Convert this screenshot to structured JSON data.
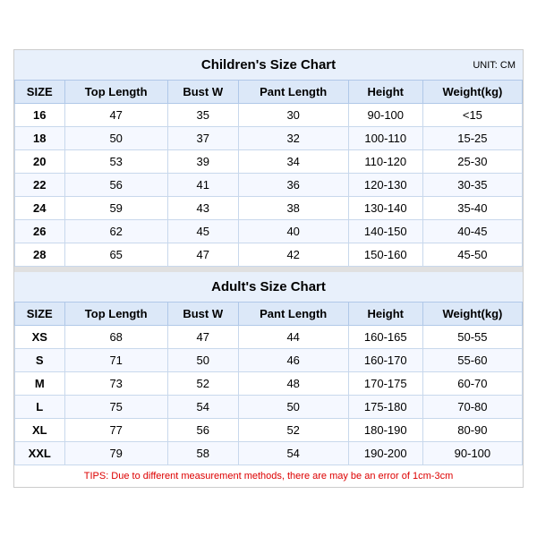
{
  "children_title": "Children's Size Chart",
  "adult_title": "Adult's Size Chart",
  "unit": "UNIT: CM",
  "tips": "TIPS: Due to different measurement methods, there are may be an error of 1cm-3cm",
  "columns": [
    "SIZE",
    "Top Length",
    "Bust W",
    "Pant Length",
    "Height",
    "Weight(kg)"
  ],
  "children_rows": [
    [
      "16",
      "47",
      "35",
      "30",
      "90-100",
      "<15"
    ],
    [
      "18",
      "50",
      "37",
      "32",
      "100-110",
      "15-25"
    ],
    [
      "20",
      "53",
      "39",
      "34",
      "110-120",
      "25-30"
    ],
    [
      "22",
      "56",
      "41",
      "36",
      "120-130",
      "30-35"
    ],
    [
      "24",
      "59",
      "43",
      "38",
      "130-140",
      "35-40"
    ],
    [
      "26",
      "62",
      "45",
      "40",
      "140-150",
      "40-45"
    ],
    [
      "28",
      "65",
      "47",
      "42",
      "150-160",
      "45-50"
    ]
  ],
  "adult_rows": [
    [
      "XS",
      "68",
      "47",
      "44",
      "160-165",
      "50-55"
    ],
    [
      "S",
      "71",
      "50",
      "46",
      "160-170",
      "55-60"
    ],
    [
      "M",
      "73",
      "52",
      "48",
      "170-175",
      "60-70"
    ],
    [
      "L",
      "75",
      "54",
      "50",
      "175-180",
      "70-80"
    ],
    [
      "XL",
      "77",
      "56",
      "52",
      "180-190",
      "80-90"
    ],
    [
      "XXL",
      "79",
      "58",
      "54",
      "190-200",
      "90-100"
    ]
  ]
}
